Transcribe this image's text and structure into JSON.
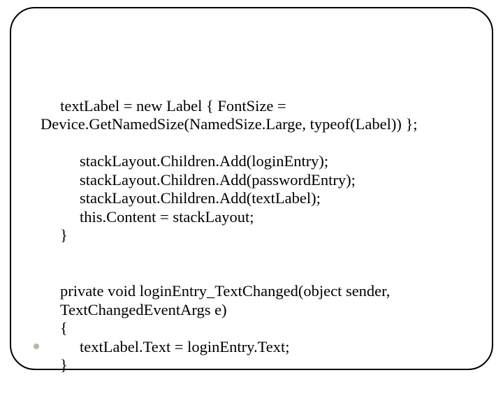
{
  "code": {
    "line1": " textLabel = new Label { FontSize = Device.GetNamedSize(NamedSize.Large, typeof(Label)) };",
    "blank1": "",
    "line2": "stackLayout.Children.Add(loginEntry);",
    "line3": "stackLayout.Children.Add(passwordEntry);",
    "line4": "stackLayout.Children.Add(textLabel);",
    "line5": "this.Content = stackLayout;",
    "line6": "}",
    "blank2": "",
    "line7": "private void loginEntry_TextChanged(object sender, TextChangedEventArgs e)",
    "line8": "{",
    "line9": "textLabel.Text = loginEntry.Text;",
    "line10": "}"
  }
}
